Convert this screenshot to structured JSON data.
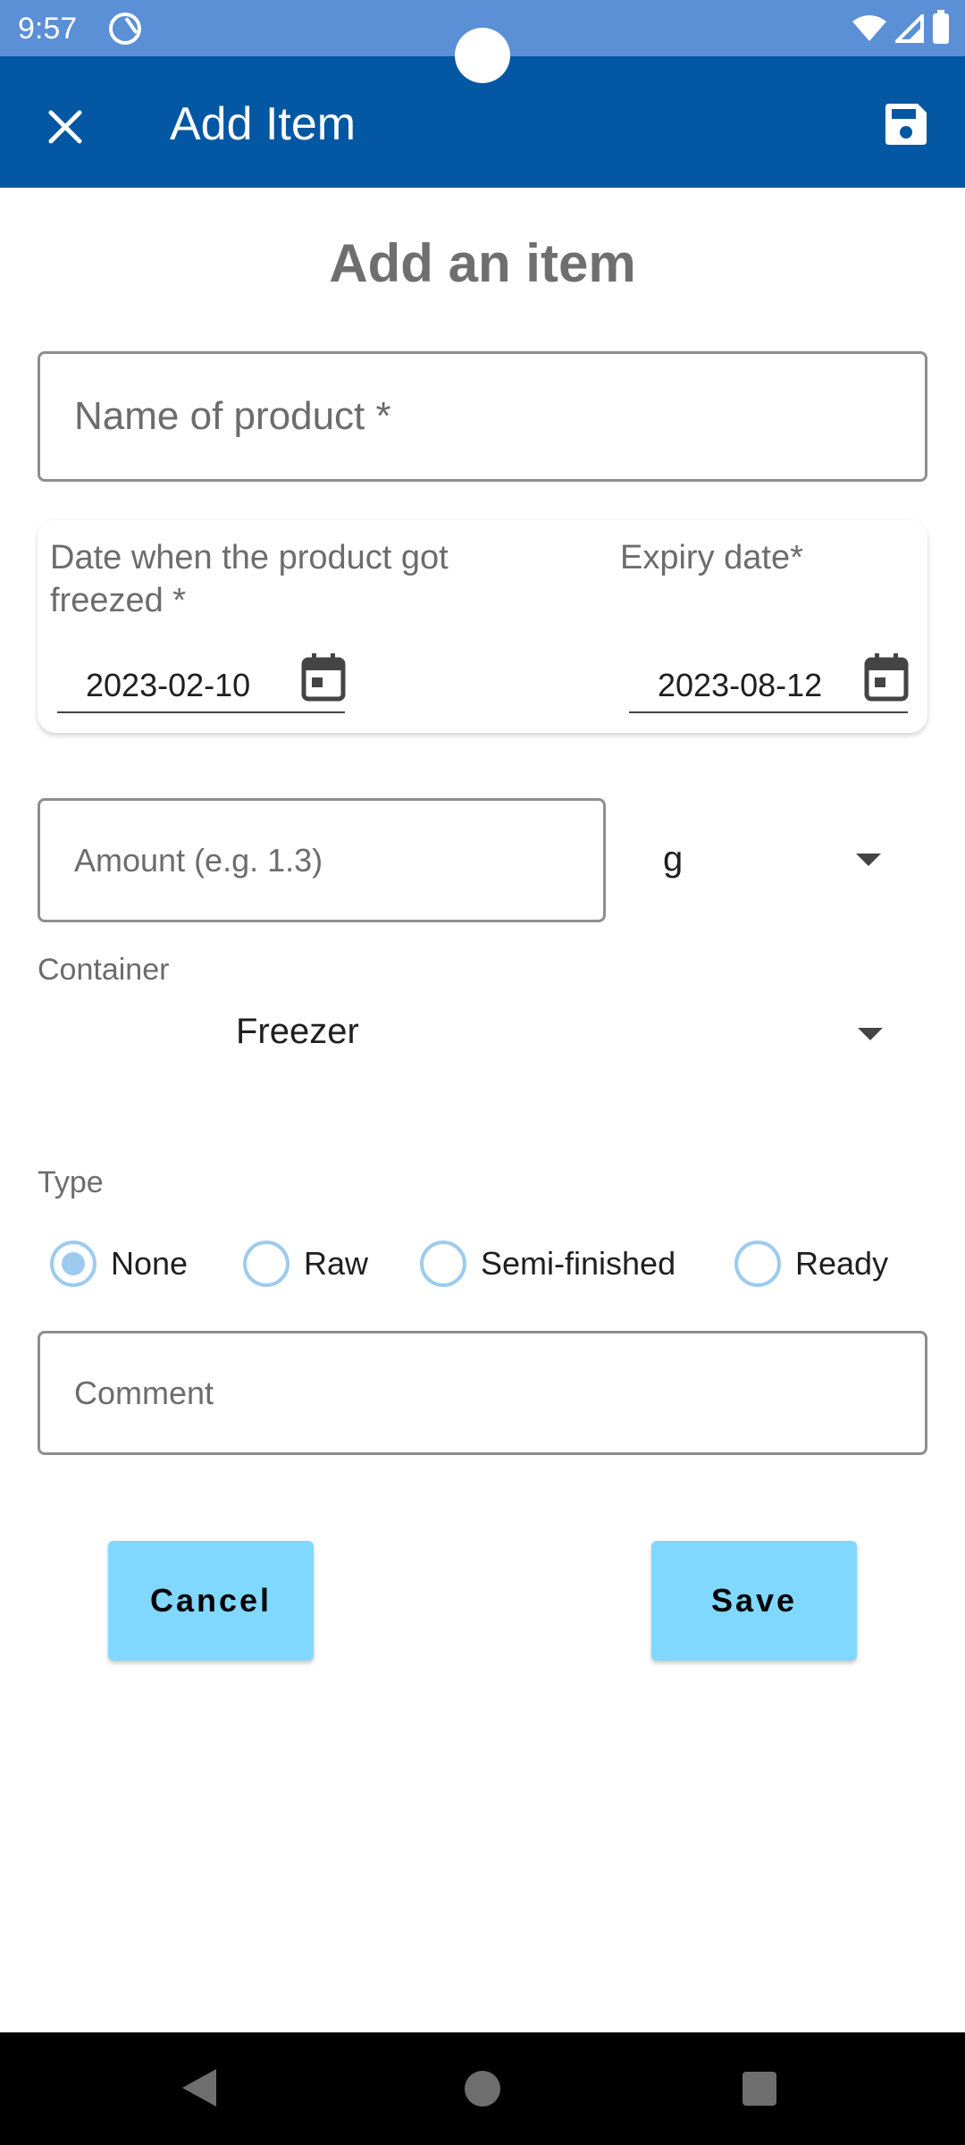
{
  "status_bar": {
    "time": "9:57"
  },
  "app_bar": {
    "title": "Add Item",
    "close_icon": "close-icon",
    "save_icon": "floppy-disk-icon"
  },
  "form": {
    "heading": "Add an item",
    "name_placeholder": "Name of product *",
    "freeze_date_label": "Date when the product got freezed *",
    "freeze_date_value": "2023-02-10",
    "expiry_date_label": "Expiry date*",
    "expiry_date_value": "2023-08-12",
    "amount_placeholder": "Amount (e.g. 1.3)",
    "unit_value": "g",
    "container_label": "Container",
    "container_value": "Freezer",
    "type_label": "Type",
    "type_options": [
      {
        "label": "None",
        "selected": true
      },
      {
        "label": "Raw",
        "selected": false
      },
      {
        "label": "Semi-finished",
        "selected": false
      },
      {
        "label": "Ready",
        "selected": false
      }
    ],
    "comment_placeholder": "Comment",
    "cancel_label": "Cancel",
    "save_label": "Save"
  },
  "colors": {
    "status_bar": "#5b8fd6",
    "app_bar": "#0457a3",
    "button": "#80d8ff",
    "radio": "#9ccbef"
  }
}
